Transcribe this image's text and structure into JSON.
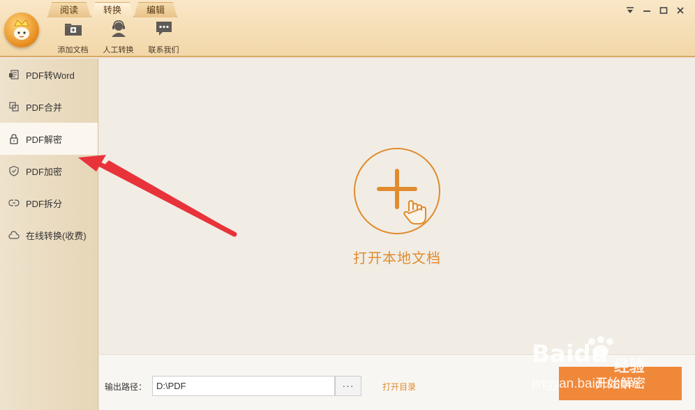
{
  "header": {
    "tabs": [
      {
        "label": "阅读"
      },
      {
        "label": "转换"
      },
      {
        "label": "编辑"
      }
    ],
    "tools": [
      {
        "label": "添加文档",
        "icon": "folder-add-icon"
      },
      {
        "label": "人工转换",
        "icon": "support-agent-icon"
      },
      {
        "label": "联系我们",
        "icon": "chat-bubble-icon"
      }
    ],
    "window_controls": [
      "dropdown-icon",
      "minimize-icon",
      "maximize-icon",
      "close-icon"
    ]
  },
  "sidebar": {
    "items": [
      {
        "label": "PDF转Word",
        "icon": "word-doc-icon",
        "active": false
      },
      {
        "label": "PDF合并",
        "icon": "merge-icon",
        "active": false
      },
      {
        "label": "PDF解密",
        "icon": "unlock-icon",
        "active": true
      },
      {
        "label": "PDF加密",
        "icon": "shield-icon",
        "active": false
      },
      {
        "label": "PDF拆分",
        "icon": "split-icon",
        "active": false
      },
      {
        "label": "在线转换(收费)",
        "icon": "cloud-icon",
        "active": false
      }
    ]
  },
  "main": {
    "open_label": "打开本地文档"
  },
  "bottom": {
    "output_label": "输出路径：",
    "output_path": "D:\\PDF",
    "browse_label": "···",
    "open_dir_label": "打开目录",
    "start_label": "开始解密"
  },
  "watermark": {
    "brand": "Bai",
    "brand_suffix": "du",
    "cn": "经验",
    "site": "jingyan.baidu.com"
  },
  "colors": {
    "accent": "#e08b2e",
    "start_button": "#f0883a",
    "annotation_arrow": "#e8333a"
  }
}
